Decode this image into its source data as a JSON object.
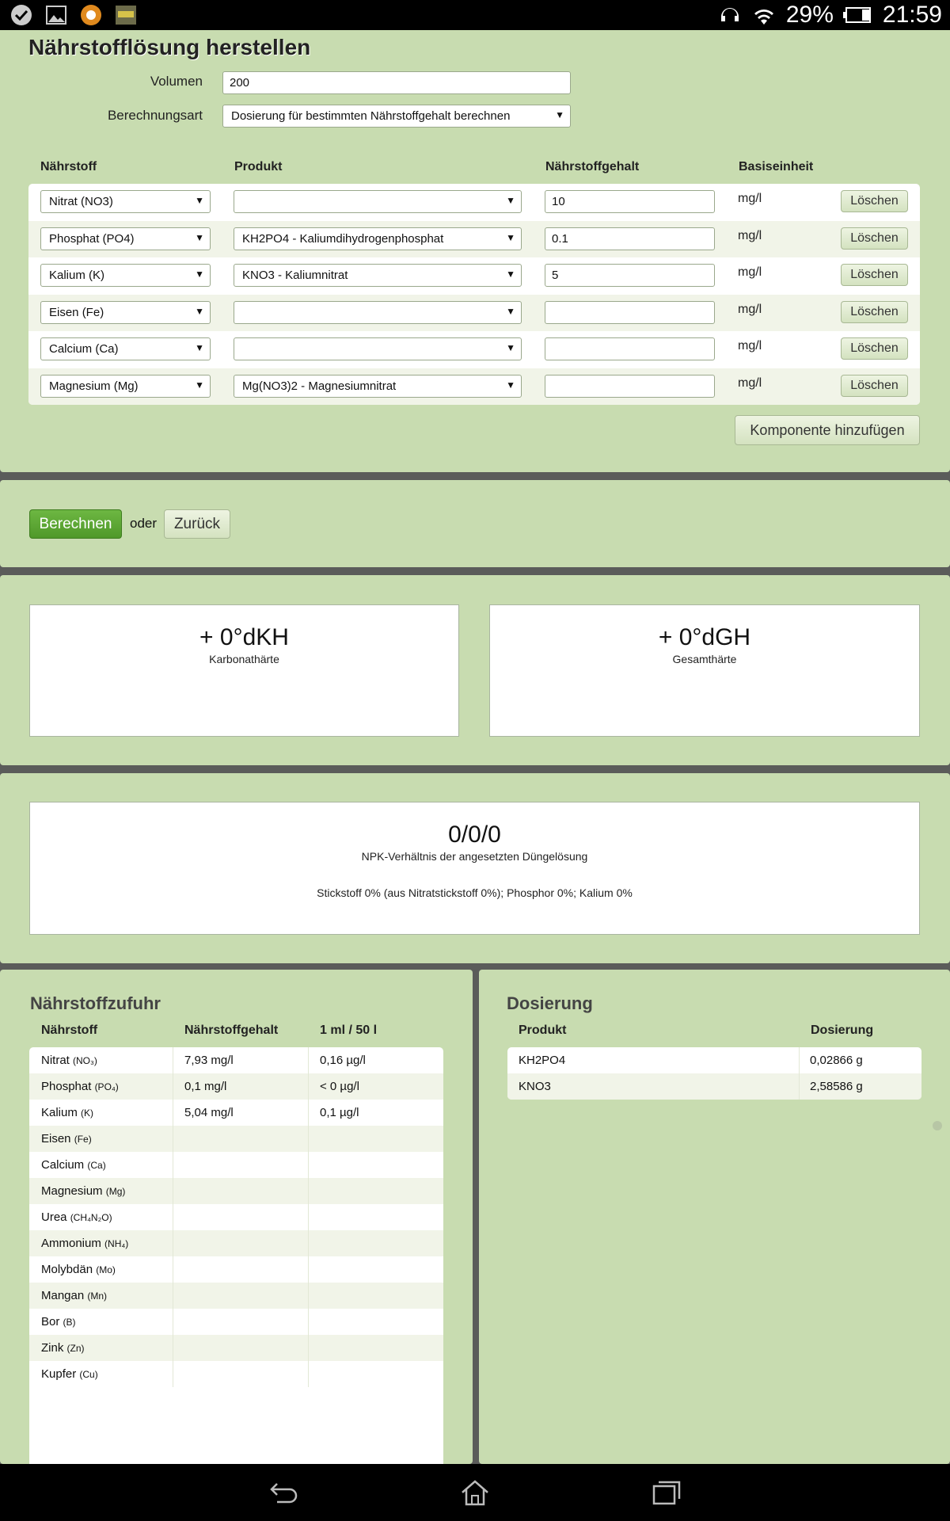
{
  "status": {
    "battery": "29%",
    "time": "21:59"
  },
  "header": {
    "title": "Nährstofflösung herstellen"
  },
  "form": {
    "volume_label": "Volumen",
    "volume_value": "200",
    "calc_label": "Berechnungsart",
    "calc_value": "Dosierung für bestimmten Nährstoffgehalt berechnen"
  },
  "table": {
    "headers": [
      "Nährstoff",
      "Produkt",
      "Nährstoffgehalt",
      "Basiseinheit"
    ],
    "delete_label": "Löschen",
    "rows": [
      {
        "nutrient": "Nitrat (NO3)",
        "product": "",
        "value": "10",
        "unit": "mg/l"
      },
      {
        "nutrient": "Phosphat (PO4)",
        "product": "KH2PO4 - Kaliumdihydrogenphosphat",
        "value": "0.1",
        "unit": "mg/l"
      },
      {
        "nutrient": "Kalium (K)",
        "product": "KNO3 - Kaliumnitrat",
        "value": "5",
        "unit": "mg/l"
      },
      {
        "nutrient": "Eisen (Fe)",
        "product": "",
        "value": "",
        "unit": "mg/l"
      },
      {
        "nutrient": "Calcium (Ca)",
        "product": "",
        "value": "",
        "unit": "mg/l"
      },
      {
        "nutrient": "Magnesium (Mg)",
        "product": "Mg(NO3)2 - Magnesiumnitrat",
        "value": "",
        "unit": "mg/l"
      }
    ],
    "add_label": "Komponente hinzufügen"
  },
  "actions": {
    "calc_label": "Berechnen",
    "or_label": "oder",
    "back_label": "Zurück"
  },
  "hardness": {
    "kh_value": "+ 0°dKH",
    "kh_label": "Karbonathärte",
    "gh_value": "+ 0°dGH",
    "gh_label": "Gesamthärte"
  },
  "npk": {
    "value": "0/0/0",
    "label": "NPK-Verhältnis der angesetzten Düngelösung",
    "detail": "Stickstoff 0% (aus Nitratstickstoff 0%); Phosphor 0%; Kalium 0%"
  },
  "supply": {
    "title": "Nährstoffzufuhr",
    "headers": [
      "Nährstoff",
      "Nährstoffgehalt",
      "1 ml / 50 l"
    ],
    "rows": [
      {
        "name": "Nitrat",
        "formula": "(NO₃)",
        "content": "7,93 mg/l",
        "per": "0,16 µg/l"
      },
      {
        "name": "Phosphat",
        "formula": "(PO₄)",
        "content": "0,1 mg/l",
        "per": "< 0 µg/l"
      },
      {
        "name": "Kalium",
        "formula": "(K)",
        "content": "5,04 mg/l",
        "per": "0,1 µg/l"
      },
      {
        "name": "Eisen",
        "formula": "(Fe)",
        "content": "",
        "per": ""
      },
      {
        "name": "Calcium",
        "formula": "(Ca)",
        "content": "",
        "per": ""
      },
      {
        "name": "Magnesium",
        "formula": "(Mg)",
        "content": "",
        "per": ""
      },
      {
        "name": "Urea",
        "formula": "(CH₄N₂O)",
        "content": "",
        "per": ""
      },
      {
        "name": "Ammonium",
        "formula": "(NH₄)",
        "content": "",
        "per": ""
      },
      {
        "name": "Molybdän",
        "formula": "(Mo)",
        "content": "",
        "per": ""
      },
      {
        "name": "Mangan",
        "formula": "(Mn)",
        "content": "",
        "per": ""
      },
      {
        "name": "Bor",
        "formula": "(B)",
        "content": "",
        "per": ""
      },
      {
        "name": "Zink",
        "formula": "(Zn)",
        "content": "",
        "per": ""
      },
      {
        "name": "Kupfer",
        "formula": "(Cu)",
        "content": "",
        "per": ""
      }
    ]
  },
  "dosing": {
    "title": "Dosierung",
    "headers": [
      "Produkt",
      "Dosierung"
    ],
    "rows": [
      {
        "product": "KH2PO4",
        "amount": "0,02866 g"
      },
      {
        "product": "KNO3",
        "amount": "2,58586 g"
      }
    ]
  }
}
